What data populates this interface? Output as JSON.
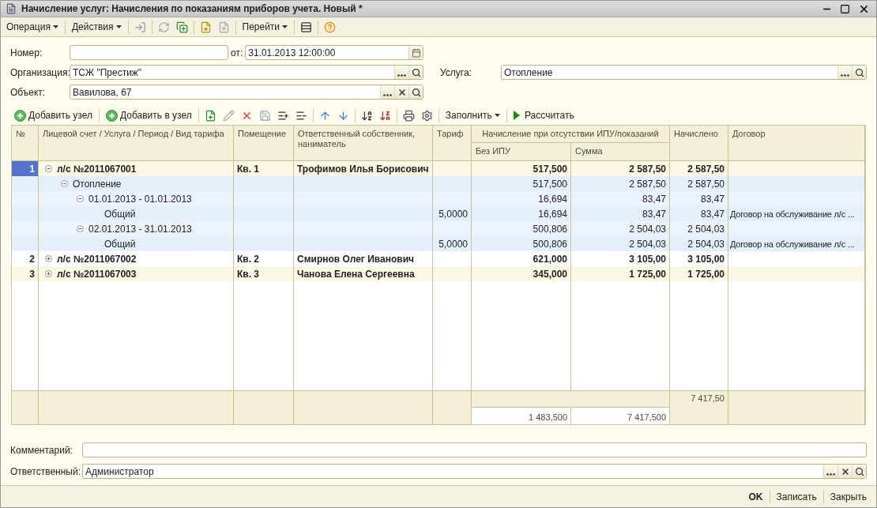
{
  "window": {
    "title": "Начисление услуг: Начисления по показаниям приборов учета. Новый *"
  },
  "toolbar": {
    "operation": "Операция",
    "actions": "Действия",
    "goto": "Перейти"
  },
  "form": {
    "number": {
      "label": "Номер:"
    },
    "date": {
      "label": "от:",
      "value": "31.01.2013 12:00:00"
    },
    "organization": {
      "label": "Организация:",
      "value": "ТСЖ \"Престиж\""
    },
    "service": {
      "label": "Услуга:",
      "value": "Отопление"
    },
    "object": {
      "label": "Объект:",
      "value": "Вавилова, 67"
    }
  },
  "table_toolbar": {
    "add_node": "Добавить узел",
    "add_to_node": "Добавить в узел",
    "fill": "Заполнить",
    "calculate": "Рассчитать"
  },
  "table": {
    "columns": {
      "number": "№",
      "name": "Лицевой счет / Услуга / Период / Вид тарифа",
      "room": "Помещение",
      "owner": "Ответственный собственник, наниматель",
      "tariff": "Тариф",
      "group": "Начисление при отсутствии ИПУ/показаний",
      "no_ipu": "Без ИПУ",
      "sum": "Сумма",
      "charged": "Начислено",
      "contract": "Договор"
    },
    "rows": [
      {
        "number": "1",
        "selected": true,
        "expanded": true,
        "name": "л/с №2011067001",
        "room": "Кв. 1",
        "owner": "Трофимов Илья Борисович",
        "no_ipu": "517,500",
        "sum": "2 587,50",
        "charged": "2 587,50",
        "children": [
          {
            "expanded": true,
            "name": "Отопление",
            "no_ipu": "517,500",
            "sum": "2 587,50",
            "charged": "2 587,50",
            "children": [
              {
                "expanded": true,
                "name": "01.01.2013 - 01.01.2013",
                "no_ipu": "16,694",
                "sum": "83,47",
                "charged": "83,47",
                "children": [
                  {
                    "name": "Общий",
                    "tariff": "5,0000",
                    "no_ipu": "16,694",
                    "sum": "83,47",
                    "charged": "83,47",
                    "contract": "Договор на обслуживание л/с ..."
                  }
                ]
              },
              {
                "expanded": true,
                "name": "02.01.2013 - 31.01.2013",
                "no_ipu": "500,806",
                "sum": "2 504,03",
                "charged": "2 504,03",
                "children": [
                  {
                    "name": "Общий",
                    "tariff": "5,0000",
                    "no_ipu": "500,806",
                    "sum": "2 504,03",
                    "charged": "2 504,03",
                    "contract": "Договор на обслуживание л/с ..."
                  }
                ]
              }
            ]
          }
        ]
      },
      {
        "number": "2",
        "selected": false,
        "expanded": false,
        "name": "л/с №2011067002",
        "room": "Кв. 2",
        "owner": "Смирнов Олег Иванович",
        "no_ipu": "621,000",
        "sum": "3 105,00",
        "charged": "3 105,00"
      },
      {
        "number": "3",
        "selected": false,
        "expanded": false,
        "name": "л/с №2011067003",
        "room": "Кв. 3",
        "owner": "Чанова Елена Сергеевна",
        "no_ipu": "345,000",
        "sum": "1 725,00",
        "charged": "1 725,00"
      }
    ],
    "totals": {
      "charged": "7 417,50",
      "no_ipu": "1 483,500",
      "sum": "7 417,500"
    }
  },
  "comment": {
    "label": "Комментарий:"
  },
  "responsible": {
    "label": "Ответственный:",
    "value": "Администратор"
  },
  "footer": {
    "ok": "OK",
    "save": "Записать",
    "close": "Закрыть"
  }
}
